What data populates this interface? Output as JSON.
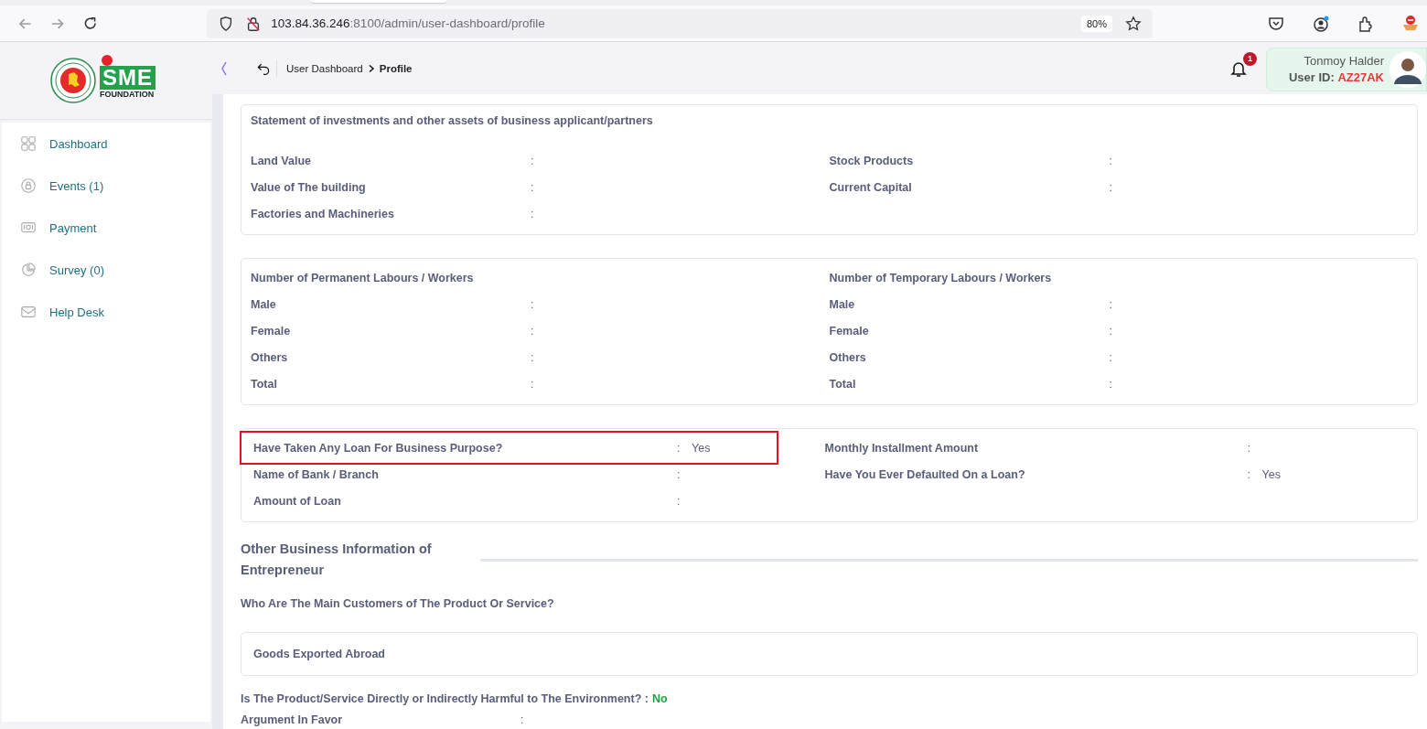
{
  "browser": {
    "url_host": "103.84.36.246",
    "url_path": ":8100/admin/user-dashboard/profile",
    "zoom": "80%"
  },
  "logo": {
    "text": "SME",
    "subtext": "FOUNDATION"
  },
  "sidebar": {
    "items": [
      {
        "label": "Dashboard",
        "selected": false
      },
      {
        "label": "Events (1)",
        "selected": false
      },
      {
        "label": "Payment",
        "selected": false
      },
      {
        "label": "Survey (0)",
        "selected": false
      },
      {
        "label": "Help Desk",
        "selected": false
      }
    ]
  },
  "header": {
    "breadcrumb": [
      {
        "label": "User Dashboard",
        "current": false
      },
      {
        "label": "Profile",
        "current": true
      }
    ],
    "notification_count": "1",
    "user": {
      "name": "Tonmoy Halder",
      "id_label": "User ID:",
      "id": "AZ27AK"
    }
  },
  "sections": [
    {
      "kind": "card",
      "title": "Statement of investments and other assets of business applicant/partners",
      "columns": [
        {
          "fields": [
            {
              "label": "Land Value",
              "colon": ":"
            },
            {
              "label": "Value of The building",
              "colon": ":"
            },
            {
              "label": "Factories and Machineries",
              "colon": ":"
            }
          ]
        },
        {
          "fields": [
            {
              "label": "Stock Products",
              "colon": ":"
            },
            {
              "label": "Current Capital",
              "colon": ":"
            }
          ]
        }
      ]
    },
    {
      "kind": "card",
      "columns": [
        {
          "heading": "Number of Permanent Labours / Workers",
          "fields": [
            {
              "label": "Male",
              "colon": ":"
            },
            {
              "label": "Female",
              "colon": ":"
            },
            {
              "label": "Others",
              "colon": ":"
            },
            {
              "label": "Total",
              "colon": ":"
            }
          ]
        },
        {
          "heading": "Number of Temporary Labours / Workers",
          "fields": [
            {
              "label": "Male",
              "colon": ":"
            },
            {
              "label": "Female",
              "colon": ":"
            },
            {
              "label": "Others",
              "colon": ":"
            },
            {
              "label": "Total",
              "colon": ":"
            }
          ]
        }
      ]
    },
    {
      "kind": "loan-card",
      "columns": [
        {
          "fields": [
            {
              "label": "Have Taken Any Loan For Business Purpose?",
              "colon": ":",
              "value": "Yes",
              "highlighted": true
            },
            {
              "label": "Name of Bank / Branch",
              "colon": ":",
              "highlighted": false
            },
            {
              "label": "Amount of Loan",
              "colon": ":",
              "highlighted": false
            }
          ]
        },
        {
          "fields": [
            {
              "label": "Monthly Installment Amount",
              "colon": ":",
              "highlighted": false
            },
            {
              "label": "Have You Ever Defaulted On a Loan?",
              "colon": ":",
              "value": "Yes",
              "highlighted": false
            }
          ]
        }
      ]
    },
    {
      "kind": "heading",
      "text": "Other Business Information of Entrepreneur"
    },
    {
      "kind": "question",
      "text": "Who Are The Main Customers of The Product Or Service?"
    },
    {
      "kind": "box",
      "text": "Goods Exported Abroad"
    },
    {
      "kind": "answer",
      "text": "Is The Product/Service Directly or Indirectly Harmful to The Environment? :",
      "value": "No"
    },
    {
      "kind": "field",
      "label": "Argument In Favor",
      "colon": ":"
    }
  ]
}
